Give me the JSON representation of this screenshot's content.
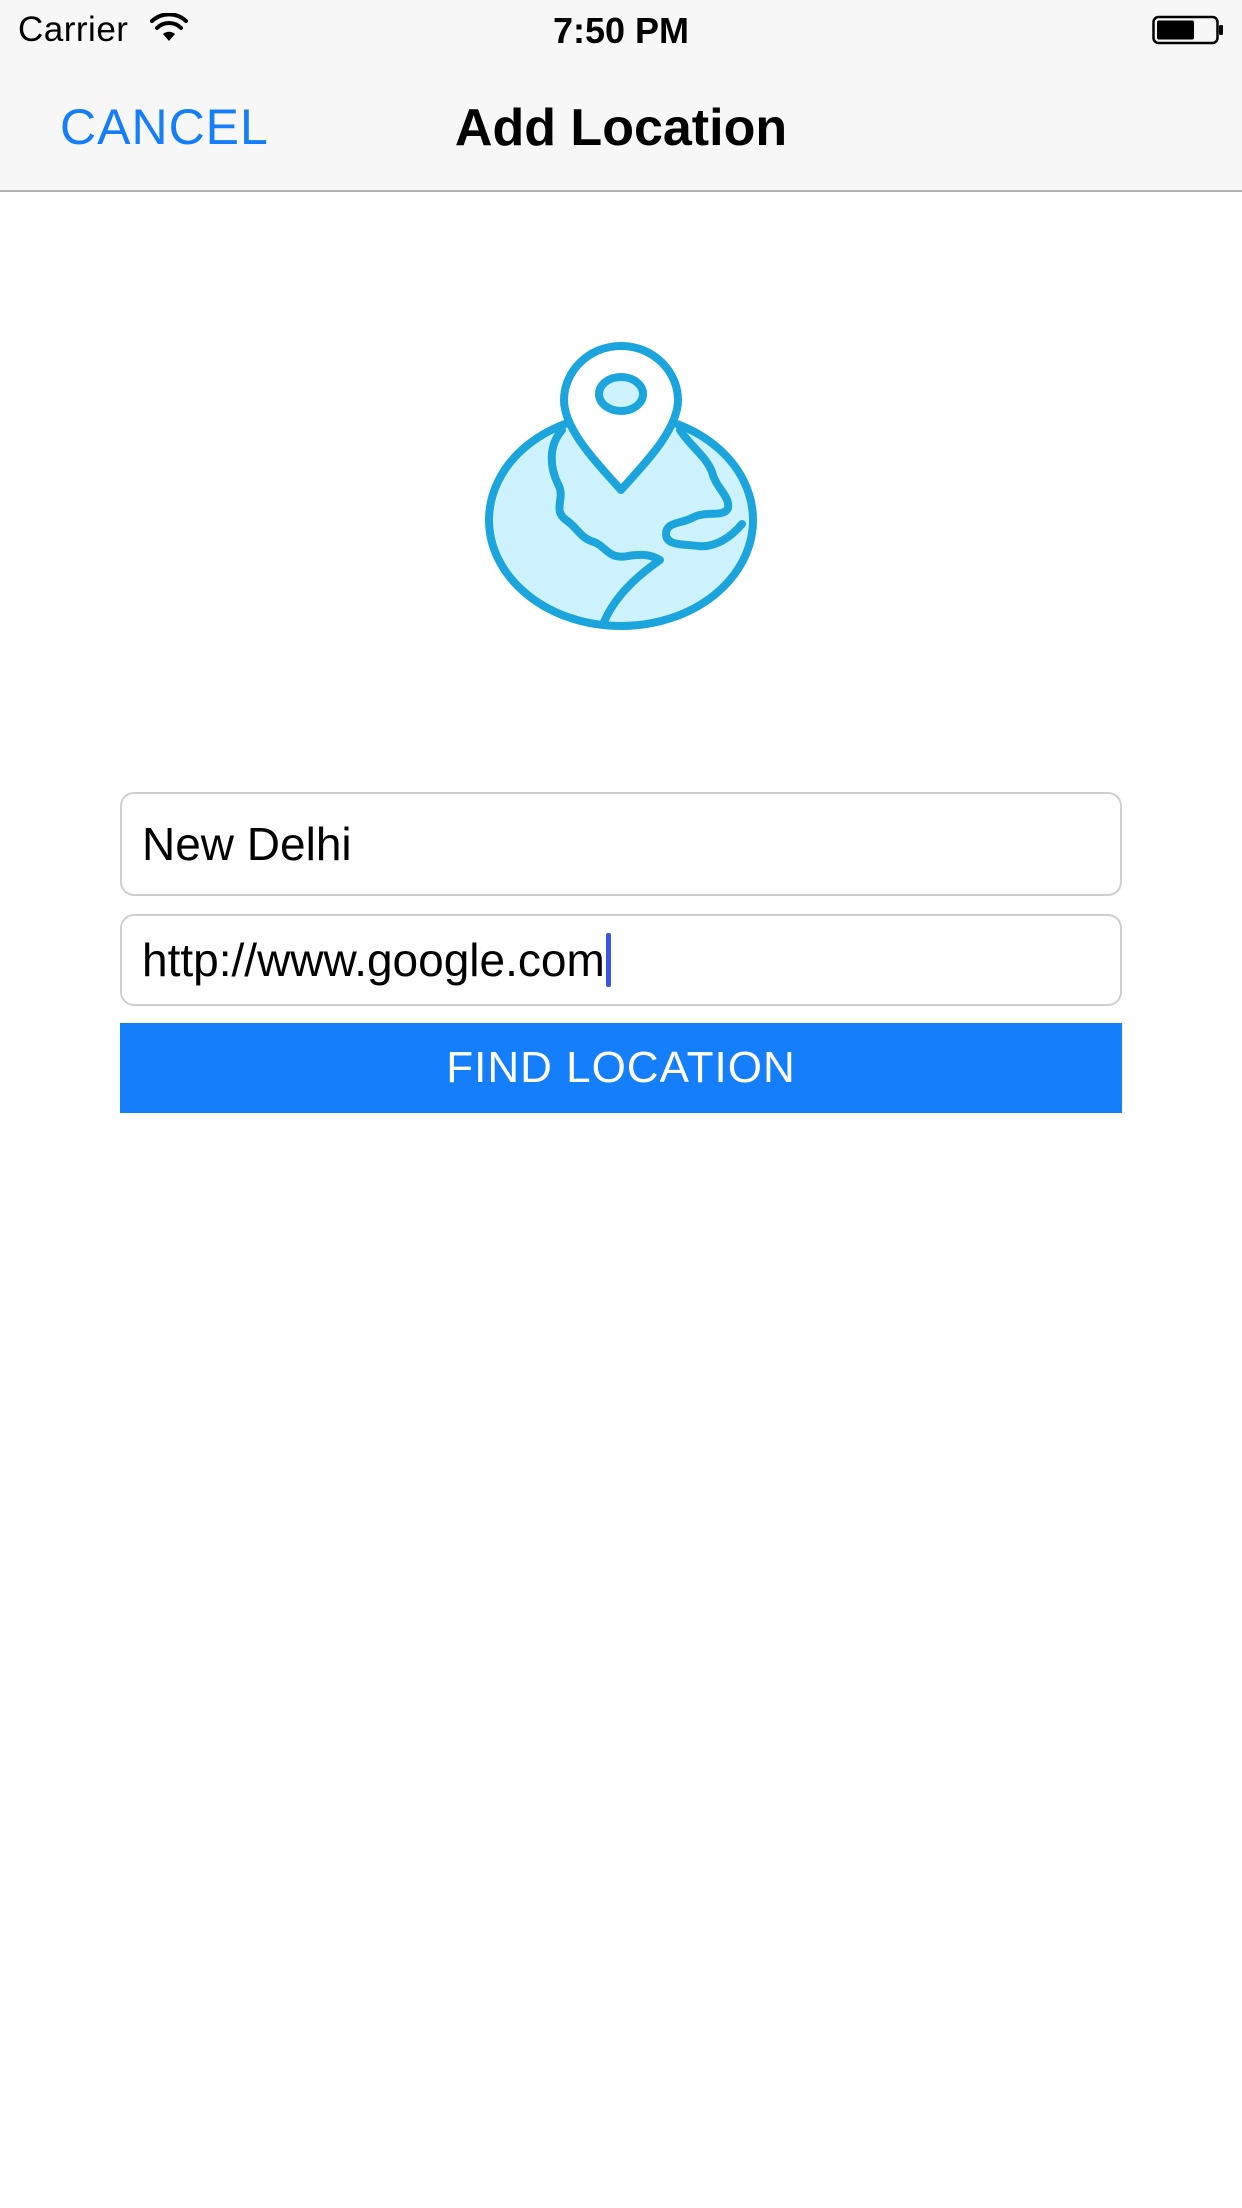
{
  "status_bar": {
    "carrier": "Carrier",
    "time": "7:50 PM",
    "wifi_icon": "wifi-icon",
    "battery_icon": "battery-icon",
    "battery_level": 0.6
  },
  "nav": {
    "cancel_label": "CANCEL",
    "title": "Add Location"
  },
  "hero_icon": "globe-location-pin-icon",
  "form": {
    "location_value": "New Delhi",
    "url_value": "http://www.google.com",
    "find_button_label": "FIND LOCATION"
  },
  "colors": {
    "accent": "#157efb",
    "icon_stroke": "#1ca4dc",
    "icon_fill": "#cdf1fd",
    "cursor": "#3a55e8",
    "bar_background": "#f7f7f7"
  }
}
